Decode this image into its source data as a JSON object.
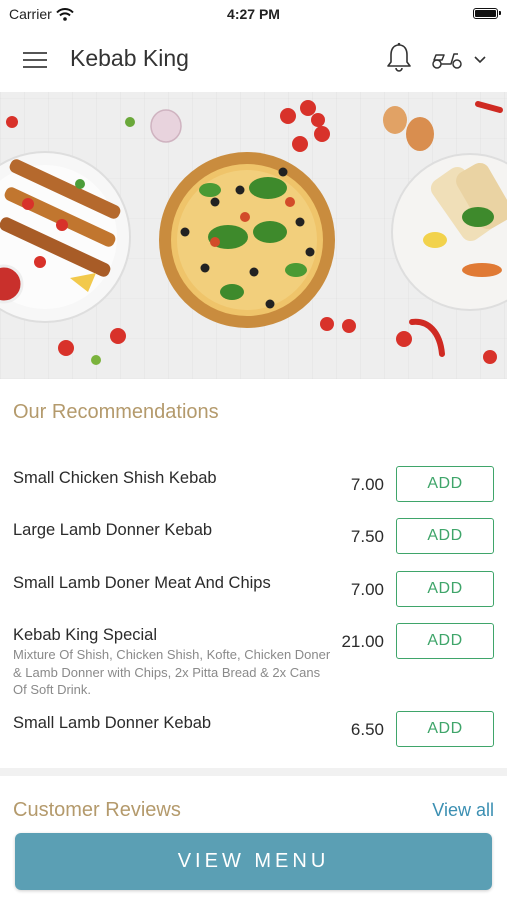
{
  "status_bar": {
    "carrier": "Carrier",
    "time": "4:27 PM"
  },
  "header": {
    "title": "Kebab King",
    "menu_icon": "hamburger-menu-icon",
    "bell_icon": "bell-icon",
    "delivery_icon": "scooter-icon",
    "chevron_icon": "chevron-down-icon"
  },
  "recommendations": {
    "title": "Our Recommendations",
    "items": [
      {
        "name": "Small Chicken Shish Kebab",
        "description": "",
        "price": "7.00",
        "add_label": "ADD"
      },
      {
        "name": "Large Lamb Donner Kebab",
        "description": "",
        "price": "7.50",
        "add_label": "ADD"
      },
      {
        "name": "Small Lamb Doner Meat And Chips",
        "description": "",
        "price": "7.00",
        "add_label": "ADD"
      },
      {
        "name": "Kebab King Special",
        "description": "Mixture Of Shish, Chicken Shish, Kofte, Chicken Doner & Lamb Donner with Chips, 2x Pitta Bread & 2x Cans Of Soft Drink.",
        "price": "21.00",
        "add_label": "ADD"
      },
      {
        "name": "Small Lamb Donner Kebab",
        "description": "",
        "price": "6.50",
        "add_label": "ADD"
      }
    ]
  },
  "reviews": {
    "title": "Customer Reviews",
    "view_all": "View all"
  },
  "view_menu": {
    "label": "VIEW MENU"
  },
  "colors": {
    "accent_gold": "#b49a6c",
    "add_green": "#3fa56a",
    "link_blue": "#3b8fb2",
    "button_blue": "#5b9fb4"
  }
}
